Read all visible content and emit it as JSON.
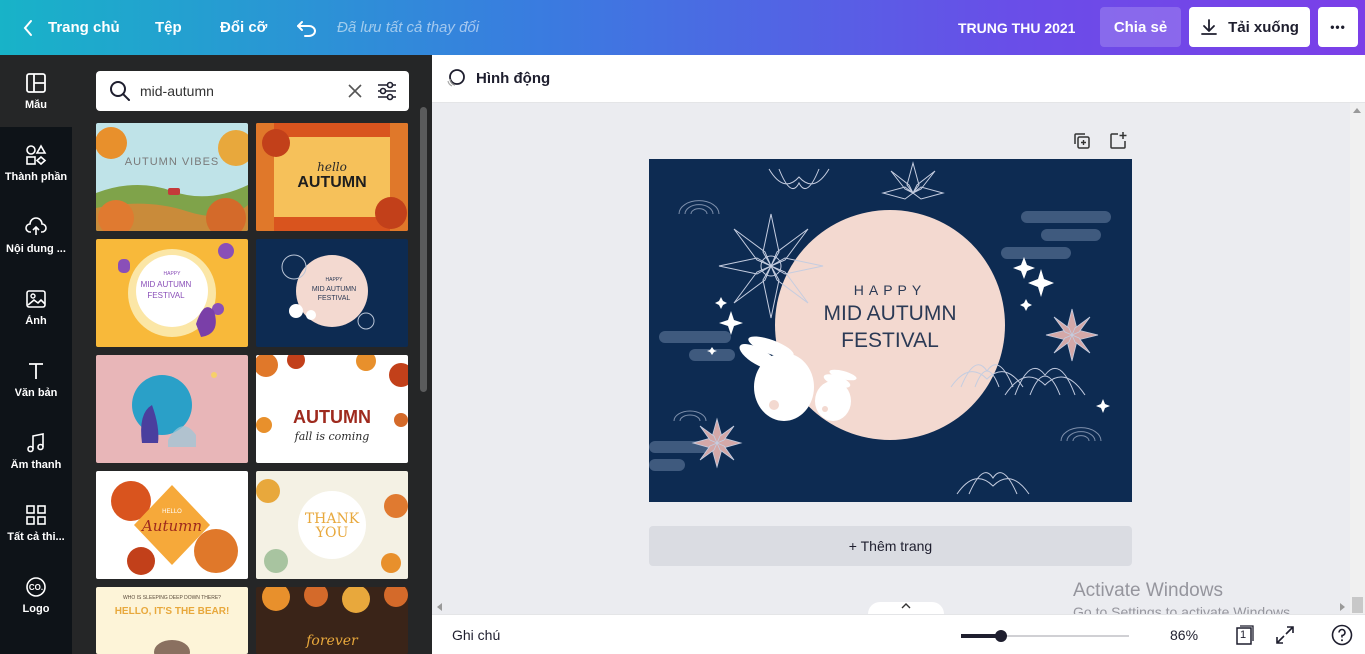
{
  "topbar": {
    "home_label": "Trang chủ",
    "file_label": "Tệp",
    "resize_label": "Đổi cỡ",
    "saved_status": "Đã lưu tất cả thay đổi",
    "project_title": "TRUNG THU 2021",
    "share_label": "Chia sẻ",
    "download_label": "Tải xuống",
    "more_label": "•••"
  },
  "rail": {
    "items": [
      {
        "label": "Mẫu",
        "icon": "layout-icon"
      },
      {
        "label": "Thành phần",
        "icon": "shapes-icon"
      },
      {
        "label": "Nội dung ...",
        "icon": "cloud-upload-icon"
      },
      {
        "label": "Ảnh",
        "icon": "image-icon"
      },
      {
        "label": "Văn bản",
        "icon": "text-icon"
      },
      {
        "label": "Âm thanh",
        "icon": "music-icon"
      },
      {
        "label": "Tất cả thi...",
        "icon": "apps-icon"
      },
      {
        "label": "Logo",
        "icon": "logo-icon"
      }
    ]
  },
  "search": {
    "value": "mid-autumn"
  },
  "thumbnails": {
    "t1": {
      "line1": "AUTUMN VIBES"
    },
    "t2": {
      "line1": "hello",
      "line2": "AUTUMN"
    },
    "t3": {
      "line1": "HAPPY",
      "line2": "MID AUTUMN",
      "line3": "FESTIVAL"
    },
    "t4": {
      "line1": "HAPPY",
      "line2": "MID AUTUMN",
      "line3": "FESTIVAL"
    },
    "t6": {
      "line1": "AUTUMN",
      "line2": "fall is coming"
    },
    "t7": {
      "line1": "HELLO",
      "line2": "Autumn"
    },
    "t8": {
      "line1": "THANK",
      "line2": "YOU"
    },
    "t9": {
      "line1": "WHO IS SLEEPING DEEP DOWN THERE?",
      "line2": "HELLO, IT'S THE BEAR!"
    },
    "t10": {
      "line1": "forever"
    }
  },
  "editor": {
    "animate_label": "Hình động",
    "add_page_label": "+ Thêm trang",
    "design": {
      "happy": "HAPPY",
      "line1": "MID AUTUMN",
      "line2": "FESTIVAL"
    }
  },
  "bottombar": {
    "notes_label": "Ghi chú",
    "zoom_value": "86%",
    "page_count": "1",
    "zoom_level": 0.24
  },
  "watermark": {
    "line1": "Activate Windows",
    "line2": "Go to Settings to activate Windows."
  },
  "colors": {
    "design_bg": "#0d2b52",
    "moon": "#f3d9d0",
    "rail_bg": "#0e1318",
    "panel_bg": "#252627"
  }
}
